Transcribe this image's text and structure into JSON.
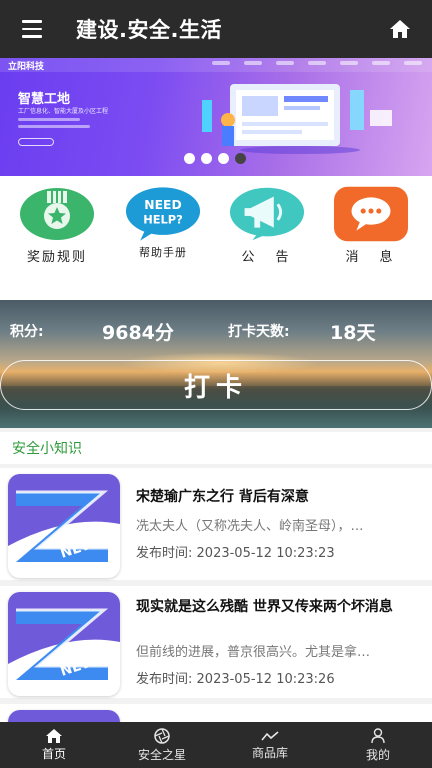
{
  "header": {
    "title": "建设.安全.生活",
    "menu_icon": "hamburger-icon",
    "home_icon": "home-icon"
  },
  "banner": {
    "logo_text": "立阳科技",
    "heading": "智慧工地",
    "subtitle": "工厂信息化、智能大厦及小区工程",
    "slide_count": 4,
    "active_slide": 4
  },
  "quick_links": [
    {
      "label": "奖励规则",
      "icon": "medal-icon"
    },
    {
      "label": "帮助手册",
      "icon": "help-bubble-icon"
    },
    {
      "label": "公　告",
      "icon": "megaphone-icon"
    },
    {
      "label": "消　息",
      "icon": "message-icon"
    }
  ],
  "checkin": {
    "points_label": "积分:",
    "points_value": "9684分",
    "days_label": "打卡天数:",
    "days_value": "18天",
    "button_label": "打卡"
  },
  "section": {
    "title": "安全小知识"
  },
  "news": [
    {
      "title": "宋楚瑜广东之行 背后有深意",
      "excerpt": "冼太夫人（又称冼夫人、岭南圣母），…",
      "time_label": "发布时间:",
      "time": "2023-05-12 10:23:23"
    },
    {
      "title": "现实就是这么残酷 世界又传来两个坏消息",
      "excerpt": "但前线的进展，普京很高兴。尤其是拿…",
      "time_label": "发布时间:",
      "time": "2023-05-12 10:23:26"
    }
  ],
  "bottom_nav": [
    {
      "label": "首页",
      "icon": "home-icon",
      "active": true
    },
    {
      "label": "安全之星",
      "icon": "aperture-icon",
      "active": false
    },
    {
      "label": "商品库",
      "icon": "chart-line-icon",
      "active": false
    },
    {
      "label": "我的",
      "icon": "user-icon",
      "active": false
    }
  ],
  "colors": {
    "header_bg": "#2b2b2b",
    "section_title": "#2e9b3a"
  }
}
